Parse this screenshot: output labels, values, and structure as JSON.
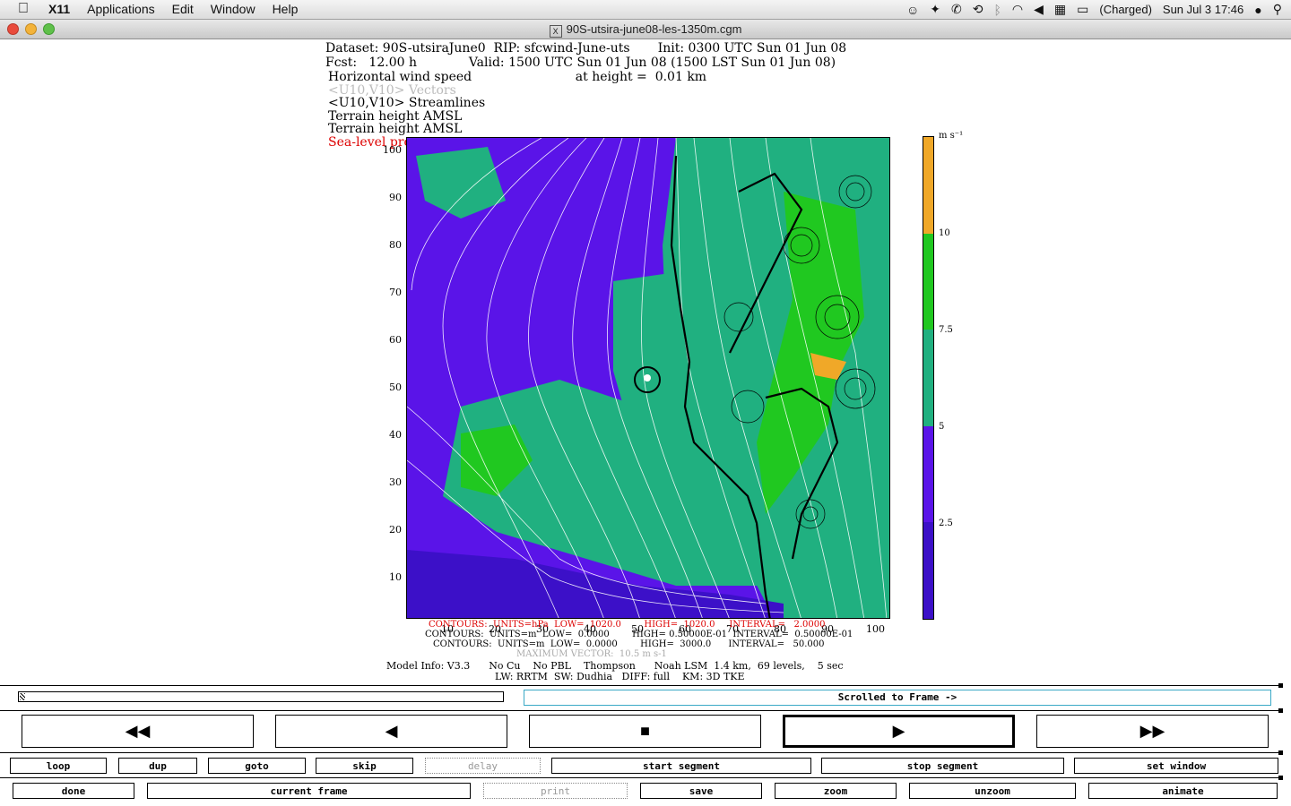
{
  "menubar": {
    "apple": "",
    "app": "X11",
    "items": [
      "Applications",
      "Edit",
      "Window",
      "Help"
    ],
    "battery": "(Charged)",
    "datetime": "Sun Jul 3  17:46"
  },
  "window": {
    "title": "90S-utsira-june08-les-1350m.cgm"
  },
  "header": {
    "dataset": "Dataset: 90S-utsiraJune0  RIP: sfcwind-June-uts       Init: 0300 UTC Sun 01 Jun 08",
    "fcst": "Fcst:   12.00 h             Valid: 1500 UTC Sun 01 Jun 08 (1500 LST Sun 01 Jun 08)",
    "field1": "Horizontal wind speed                          at height =  0.01 km",
    "field2": "<U10,V10> Vectors",
    "field3": "<U10,V10> Streamlines",
    "field4": "Terrain height AMSL",
    "field5": "Terrain height AMSL",
    "field6": "Sea-level pressure"
  },
  "plot": {
    "yticks": [
      "100",
      "90",
      "80",
      "70",
      "60",
      "50",
      "40",
      "30",
      "20",
      "10"
    ],
    "xticks": [
      "10",
      "20",
      "30",
      "40",
      "50",
      "60",
      "70",
      "80",
      "90",
      "100"
    ]
  },
  "colorbar": {
    "units": "m s⁻¹",
    "labels": [
      "10",
      "7.5",
      "5",
      "2.5"
    ],
    "colors": [
      "#f0a828",
      "#20c820",
      "#20b080",
      "#5a14e8",
      "#3c10c8"
    ]
  },
  "footer": {
    "c1": "CONTOURS:  UNITS=hPa  LOW=  1020.0        HIGH=  1020.0     INTERVAL=   2.0000",
    "c2": "CONTOURS:  UNITS=m  LOW=  0.0000        HIGH= 0.50000E-01  INTERVAL=  0.50000E-01",
    "c3": "CONTOURS:  UNITS=m  LOW=  0.0000        HIGH=  3000.0      INTERVAL=   50.000",
    "maxvec": "MAXIMUM VECTOR:  10.5 m s-1",
    "model1": "Model Info: V3.3      No Cu    No PBL    Thompson      Noah LSM  1.4 km,  69 levels,    5 sec",
    "model2": "LW: RRTM  SW: Dudhia   DIFF: full    KM: 3D TKE"
  },
  "controls": {
    "frame_status": "Scrolled to Frame ->",
    "transport": [
      "◀◀",
      "◀",
      "■",
      "▶",
      "▶▶"
    ],
    "row1": [
      "loop",
      "dup",
      "goto",
      "skip",
      "delay",
      "start segment",
      "stop segment",
      "set window"
    ],
    "row2": [
      "done",
      "current frame",
      "print",
      "save",
      "zoom",
      "unzoom",
      "animate"
    ]
  }
}
